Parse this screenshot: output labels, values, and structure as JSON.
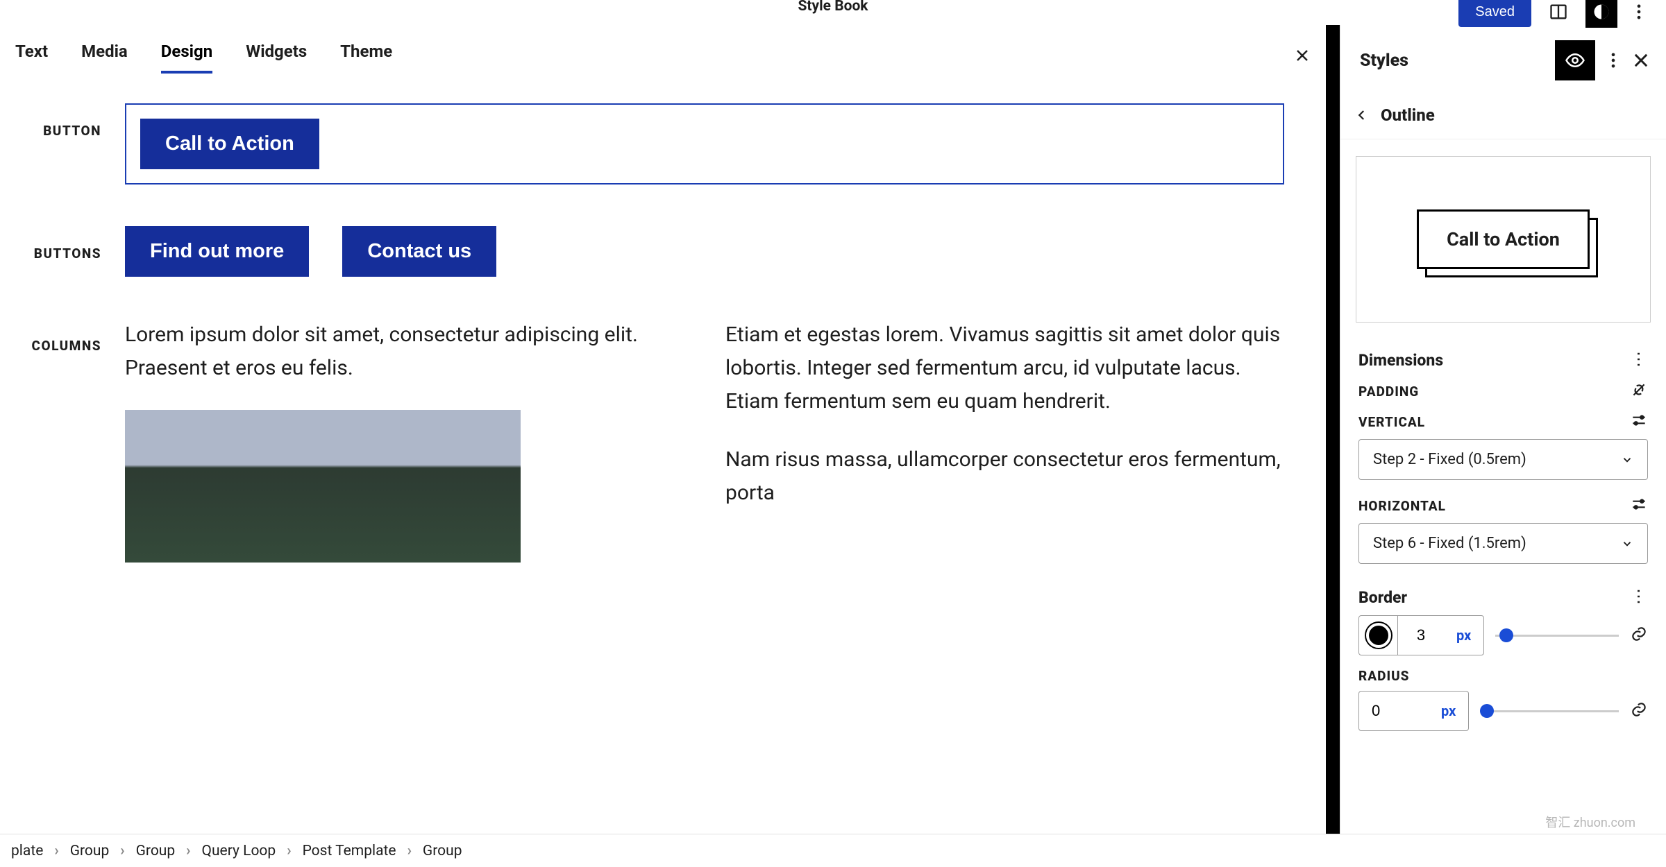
{
  "topbar": {
    "title": "Style Book",
    "saved": "Saved"
  },
  "tabs": {
    "items": [
      "Text",
      "Media",
      "Design",
      "Widgets",
      "Theme"
    ],
    "active": 2
  },
  "canvas": {
    "button_label": "BUTTON",
    "button_cta": "Call to Action",
    "buttons_label": "BUTTONS",
    "buttons": [
      "Find out more",
      "Contact us"
    ],
    "columns_label": "COLUMNS",
    "col1_p1": "Lorem ipsum dolor sit amet, consectetur adipiscing elit. Praesent et eros eu felis.",
    "col2_p1": "Etiam et egestas lorem. Vivamus sagittis sit amet dolor quis lobortis. Integer sed fermentum arcu, id vulputate lacus. Etiam fermentum sem eu quam hendrerit.",
    "col2_p2": "Nam risus massa, ullamcorper consectetur eros fermentum, porta"
  },
  "sidepanel": {
    "title": "Styles",
    "back": "Outline",
    "preview_label": "Call to Action",
    "dimensions": "Dimensions",
    "padding": "PADDING",
    "vertical_label": "VERTICAL",
    "vertical_value": "Step 2 - Fixed (0.5rem)",
    "horizontal_label": "HORIZONTAL",
    "horizontal_value": "Step 6 - Fixed (1.5rem)",
    "border": "Border",
    "border_width": "3",
    "border_unit": "px",
    "radius": "RADIUS",
    "radius_value": "0",
    "radius_unit": "px"
  },
  "breadcrumb": [
    "plate",
    "Group",
    "Group",
    "Query Loop",
    "Post Template",
    "Group"
  ],
  "watermark": {
    "cn": "智汇 zhuon.com"
  }
}
